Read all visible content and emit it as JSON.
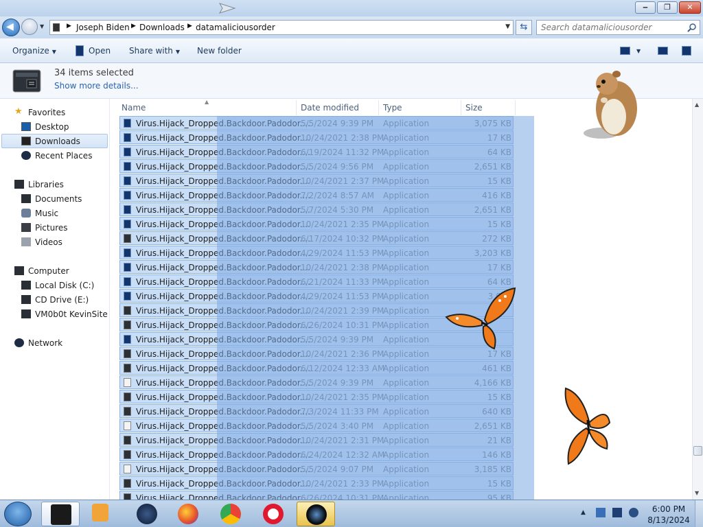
{
  "window": {
    "minimize_label": "‒",
    "maximize_label": "❐",
    "close_label": "✕"
  },
  "address": {
    "breadcrumbs": [
      "Joseph Biden",
      "Downloads",
      "datamaliciousorder"
    ],
    "search_placeholder": "Search datamaliciousorder"
  },
  "toolbar": {
    "organize_label": "Organize",
    "open_label": "Open",
    "share_label": "Share with",
    "new_folder_label": "New folder"
  },
  "details": {
    "selected_text": "34 items selected",
    "show_more_text": "Show more details..."
  },
  "nav": {
    "favorites": "Favorites",
    "desktop": "Desktop",
    "downloads": "Downloads",
    "recent": "Recent Places",
    "libraries": "Libraries",
    "documents": "Documents",
    "music": "Music",
    "pictures": "Pictures",
    "videos": "Videos",
    "computer": "Computer",
    "local_disk": "Local Disk (C:)",
    "cd_drive": "CD Drive (E:)",
    "vm": "VM0b0t KevinSite",
    "network": "Network"
  },
  "columns": {
    "name": "Name",
    "date": "Date modified",
    "type": "Type",
    "size": "Size"
  },
  "files": [
    {
      "name": "Virus.Hijack_Dropped.Backdoor.Padodor....",
      "date": "5/5/2024 9:39 PM",
      "type": "Application",
      "size": "3,075 KB",
      "icon": "blue"
    },
    {
      "name": "Virus.Hijack_Dropped.Backdoor.Padodor....",
      "date": "10/24/2021 2:38 PM",
      "type": "Application",
      "size": "17 KB",
      "icon": "blue"
    },
    {
      "name": "Virus.Hijack_Dropped.Backdoor.Padodor....",
      "date": "6/19/2024 11:32 PM",
      "type": "Application",
      "size": "64 KB",
      "icon": "blue"
    },
    {
      "name": "Virus.Hijack_Dropped.Backdoor.Padodor....",
      "date": "5/5/2024 9:56 PM",
      "type": "Application",
      "size": "2,651 KB",
      "icon": "blue"
    },
    {
      "name": "Virus.Hijack_Dropped.Backdoor.Padodor....",
      "date": "10/24/2021 2:37 PM",
      "type": "Application",
      "size": "15 KB",
      "icon": "blue"
    },
    {
      "name": "Virus.Hijack_Dropped.Backdoor.Padodor....",
      "date": "7/2/2024 8:57 AM",
      "type": "Application",
      "size": "416 KB",
      "icon": "blue"
    },
    {
      "name": "Virus.Hijack_Dropped.Backdoor.Padodor....",
      "date": "5/7/2024 5:30 PM",
      "type": "Application",
      "size": "2,651 KB",
      "icon": "blue"
    },
    {
      "name": "Virus.Hijack_Dropped.Backdoor.Padodor....",
      "date": "10/24/2021 2:35 PM",
      "type": "Application",
      "size": "15 KB",
      "icon": "blue"
    },
    {
      "name": "Virus.Hijack_Dropped.Backdoor.Padodor....",
      "date": "6/17/2024 10:32 PM",
      "type": "Application",
      "size": "272 KB",
      "icon": "dark"
    },
    {
      "name": "Virus.Hijack_Dropped.Backdoor.Padodor....",
      "date": "4/29/2024 11:53 PM",
      "type": "Application",
      "size": "3,203 KB",
      "icon": "blue"
    },
    {
      "name": "Virus.Hijack_Dropped.Backdoor.Padodor....",
      "date": "10/24/2021 2:38 PM",
      "type": "Application",
      "size": "17 KB",
      "icon": "blue"
    },
    {
      "name": "Virus.Hijack_Dropped.Backdoor.Padodor....",
      "date": "6/21/2024 11:33 PM",
      "type": "Application",
      "size": "64 KB",
      "icon": "blue"
    },
    {
      "name": "Virus.Hijack_Dropped.Backdoor.Padodor....",
      "date": "4/29/2024 11:53 PM",
      "type": "Application",
      "size": "3,075",
      "icon": "blue"
    },
    {
      "name": "Virus.Hijack_Dropped.Backdoor.Padodor....",
      "date": "10/24/2021 2:39 PM",
      "type": "Application",
      "size": "",
      "icon": "dark"
    },
    {
      "name": "Virus.Hijack_Dropped.Backdoor.Padodor....",
      "date": "6/26/2024 10:31 PM",
      "type": "Application",
      "size": "",
      "icon": "dark"
    },
    {
      "name": "Virus.Hijack_Dropped.Backdoor.Padodor....",
      "date": "5/5/2024 9:39 PM",
      "type": "Application",
      "size": "",
      "icon": "blue"
    },
    {
      "name": "Virus.Hijack_Dropped.Backdoor.Padodor....",
      "date": "10/24/2021 2:36 PM",
      "type": "Application",
      "size": "17 KB",
      "icon": "dark"
    },
    {
      "name": "Virus.Hijack_Dropped.Backdoor.Padodor....",
      "date": "6/12/2024 12:33 AM",
      "type": "Application",
      "size": "461 KB",
      "icon": "dark"
    },
    {
      "name": "Virus.Hijack_Dropped.Backdoor.Padodor....",
      "date": "5/5/2024 9:39 PM",
      "type": "Application",
      "size": "4,166 KB",
      "icon": "gear"
    },
    {
      "name": "Virus.Hijack_Dropped.Backdoor.Padodor....",
      "date": "10/24/2021 2:35 PM",
      "type": "Application",
      "size": "15 KB",
      "icon": "dark"
    },
    {
      "name": "Virus.Hijack_Dropped.Backdoor.Padodor....",
      "date": "7/3/2024 11:33 PM",
      "type": "Application",
      "size": "640 KB",
      "icon": "dark"
    },
    {
      "name": "Virus.Hijack_Dropped.Backdoor.Padodor....",
      "date": "5/5/2024 3:40 PM",
      "type": "Application",
      "size": "2,651 KB",
      "icon": "gear"
    },
    {
      "name": "Virus.Hijack_Dropped.Backdoor.Padodor....",
      "date": "10/24/2021 2:31 PM",
      "type": "Application",
      "size": "21 KB",
      "icon": "dark"
    },
    {
      "name": "Virus.Hijack_Dropped.Backdoor.Padodor....",
      "date": "6/24/2024 12:32 AM",
      "type": "Application",
      "size": "146 KB",
      "icon": "dark"
    },
    {
      "name": "Virus.Hijack_Dropped.Backdoor.Padodor....",
      "date": "5/5/2024 9:07 PM",
      "type": "Application",
      "size": "3,185 KB",
      "icon": "gear"
    },
    {
      "name": "Virus.Hijack_Dropped.Backdoor.Padodor....",
      "date": "10/24/2021 2:33 PM",
      "type": "Application",
      "size": "15 KB",
      "icon": "dark"
    },
    {
      "name": "Virus.Hijack_Dropped.Backdoor.Padodor....",
      "date": "6/26/2024 10:31 PM",
      "type": "Application",
      "size": "95 KB",
      "icon": "dark"
    }
  ],
  "taskbar": {
    "time": "6:00 PM",
    "date": "8/13/2024"
  },
  "colors": {
    "selection": "#bdd7f5",
    "accent": "#2a63b0"
  }
}
